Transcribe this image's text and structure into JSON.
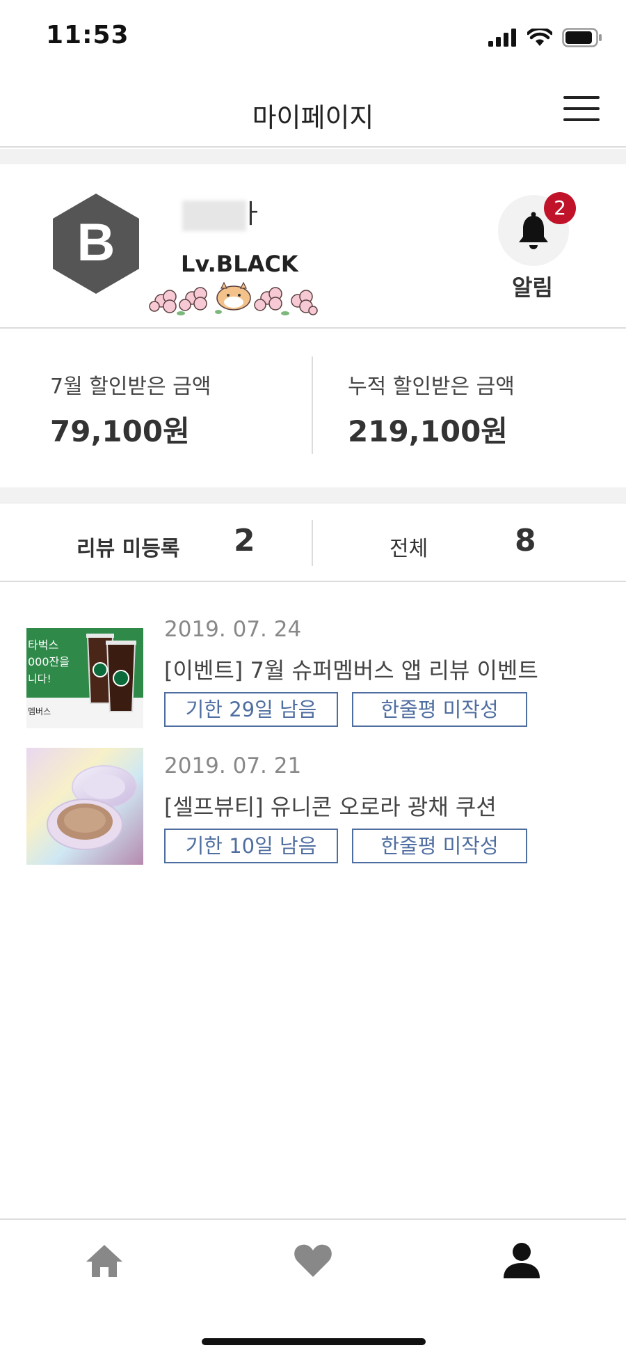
{
  "status_bar": {
    "time": "11:53",
    "icons": [
      "signal-icon",
      "wifi-icon",
      "battery-icon"
    ]
  },
  "nav": {
    "title": "마이페이지",
    "menu_icon": "hamburger-menu-icon"
  },
  "profile": {
    "badge_letter": "B",
    "name_visible_suffix": "ㅏ",
    "level": "Lv.BLACK",
    "notification_label": "알림",
    "notification_count": "2",
    "notification_icon": "bell-icon"
  },
  "discounts": {
    "monthly_label": "7월 할인받은 금액",
    "monthly_value": "79,100원",
    "total_label": "누적 할인받은 금액",
    "total_value": "219,100원"
  },
  "review_summary": {
    "pending_label": "리뷰 미등록",
    "pending_count": "2",
    "all_label": "전체",
    "all_count": "8"
  },
  "items": [
    {
      "date": "2019. 07. 24",
      "title": "[이벤트] 7월 슈퍼멤버스 앱 리뷰 이벤트",
      "deadline": "기한 29일 남음",
      "review_status": "한줄평 미작성",
      "thumb_text_1": "타벅스",
      "thumb_text_2": "000잔을",
      "thumb_text_3": "니다!",
      "thumb_text_4": "멤버스"
    },
    {
      "date": "2019. 07. 21",
      "title": "[셀프뷰티] 유니콘 오로라 광채 쿠션",
      "deadline": "기한 10일 남음",
      "review_status": "한줄평 미작성"
    }
  ],
  "tabs": [
    "home-icon",
    "heart-icon",
    "person-icon"
  ],
  "colors": {
    "accent_blue": "#4f6ea0",
    "badge_red": "#c0132a",
    "dark_gray": "#555555",
    "band_gray": "#f2f2f2"
  }
}
